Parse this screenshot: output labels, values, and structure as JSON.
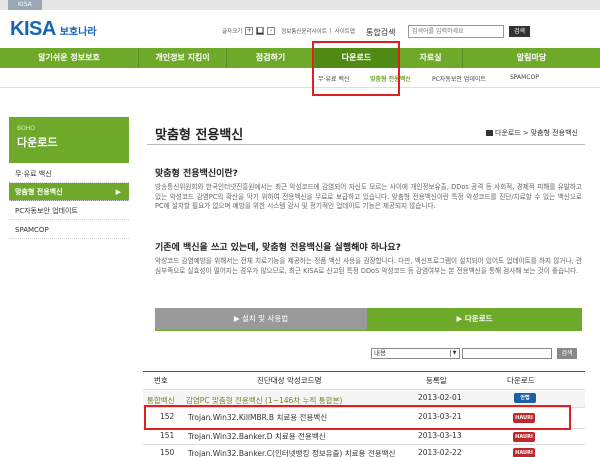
{
  "top": {
    "tab": "KISA"
  },
  "header": {
    "logo_main": "KISA",
    "logo_sub": "보호나라",
    "font_label": "글자크기",
    "font_plus": "+",
    "font_reset": "■",
    "font_minus": "-",
    "util_links": [
      "정보통신윤리사이트",
      "사이트맵"
    ],
    "search_label": "통합검색",
    "search_placeholder": "검색어를 입력하세요",
    "search_button": "검색"
  },
  "nav": {
    "items": [
      "알기쉬운 정보보호",
      "개인정보 지킴이",
      "점검하기",
      "다운로드",
      "자료실",
      "알림마당"
    ],
    "active_index": 3,
    "sub": [
      "무·유료 백신",
      "맞춤형 전용백신",
      "PC자동보안 업데이트",
      "SPAMCOP"
    ],
    "sub_active_index": 1
  },
  "sidebar": {
    "en": "BOHO",
    "title": "다운로드",
    "items": [
      "무·유료 백신",
      "맞춤형 전용백신",
      "PC자동보안 업데이트",
      "SPAMCOP"
    ],
    "active_arrow": "▶"
  },
  "content": {
    "title": "맞춤형 전용백신",
    "breadcrumb": [
      "다운로드",
      "맞춤형 전용백신"
    ],
    "q1": "맞춤형 전용백신이란?",
    "p1": "방송통신위원회와 한국인터넷진흥원에서는 최근 악성코드에 감염되어 자신도 모르는 사이에 개인정보유출, DDos 공격 등 사회적, 경제적 피해를 유발하고 있는 악성코드 감염PC의 확산을 막기 위하여 전용백신을 무료로 보급하고 있습니다. 맞춤형 전용백신이란 특정 악성코드를 진단/치료할 수 있는 백신으로 PC에 설치할 필요가 없으며 예방을 위한 시스템 감시 및 정기적인 업데이트 기능은 제공되지 않습니다.",
    "q2": "기존에 백신을 쓰고 있는데, 맞춤형 전용백신을 실행해야 하나요?",
    "p2": "악성코드 감염예방을 위해서는 전체 치료기능을 제공하는 정품 백신 사용을 권장합니다. 다만, 백신프로그램이 설치되어 있어도 업데이트를 하지 않거나, 관심부족으로 실효성이 떨어지는 경우가 많으므로, 최근 KISA로 신고된 특정 DDoS 악성코드 등 감염여부는 본 전용백신을 통해 검사해 보는 것이 좋습니다.",
    "tabs": [
      "설치 및 사용법",
      "다운로드"
    ],
    "filter_option": "내용",
    "filter_button": "검색"
  },
  "table": {
    "headers": [
      "번호",
      "진단대상 악성코드명",
      "등록일",
      "다운로드"
    ],
    "rows": [
      {
        "no": "통합백신",
        "name": "감염PC 맞춤형 전용백신 (1~146차 누적 통합본)",
        "date": "2013-02-01",
        "vendor": "안랩"
      },
      {
        "no": "152",
        "name": "Trojan.Win32.KillMBR.B 치료용 전용백신",
        "date": "2013-03-21",
        "vendor": "HAURI"
      },
      {
        "no": "151",
        "name": "Trojan.Win32.Banker.D 치료용 전용백신",
        "date": "2013-03-13",
        "vendor": "HAURI"
      },
      {
        "no": "150",
        "name": "Trojan.Win32.Banker.C(인터넷뱅킹 정보유출) 치료용 전용백신",
        "date": "2013-02-22",
        "vendor": "HAURI"
      }
    ]
  },
  "colors": {
    "brand_green": "#6ea92a",
    "brand_blue": "#1565b5",
    "highlight_red": "#e02020"
  }
}
